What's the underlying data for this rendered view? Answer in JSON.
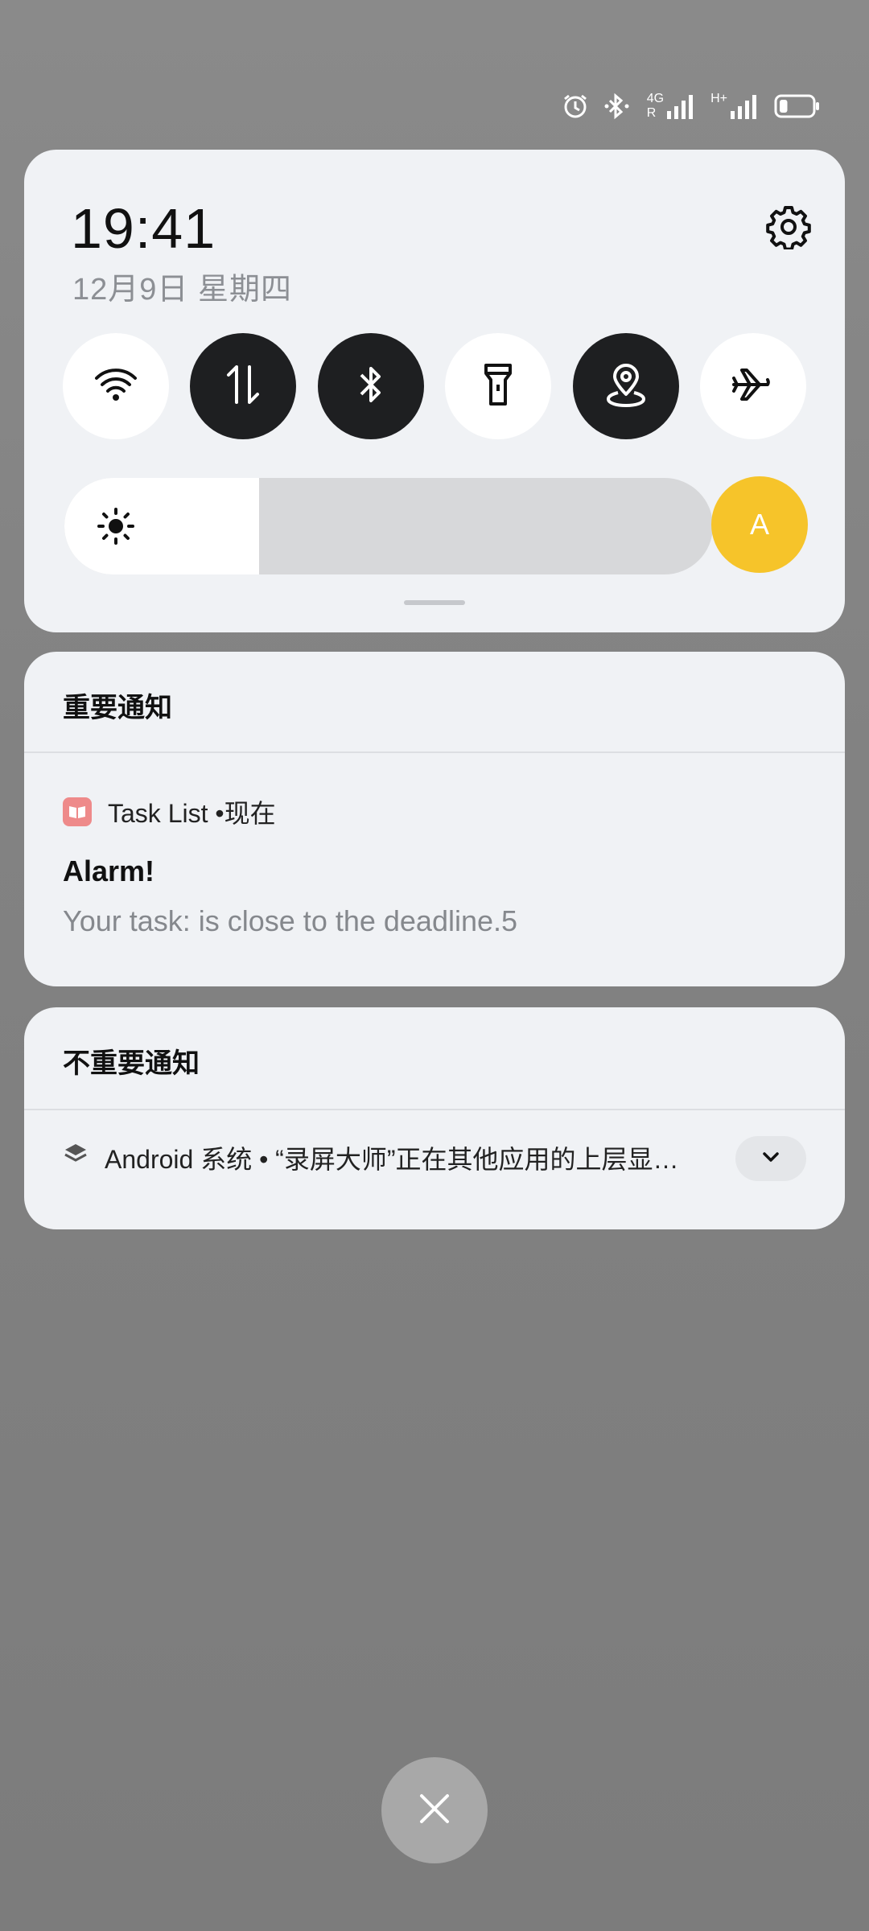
{
  "status_bar": {
    "icons": [
      "alarm-icon",
      "bluetooth-icon",
      "signal-4g-icon",
      "signal-h-plus-icon",
      "battery-icon"
    ],
    "network_1": "4G",
    "network_1_sub": "R",
    "network_2": "H+",
    "battery_level": 0.25
  },
  "quick_settings": {
    "time": "19:41",
    "date": "12月9日  星期四",
    "settings_icon": "gear-icon",
    "tiles": [
      {
        "name": "wifi",
        "icon": "wifi-icon",
        "active": false
      },
      {
        "name": "mobile-data",
        "icon": "data-arrows-icon",
        "active": true
      },
      {
        "name": "bluetooth",
        "icon": "bluetooth-icon",
        "active": true
      },
      {
        "name": "flashlight",
        "icon": "flashlight-icon",
        "active": false
      },
      {
        "name": "location",
        "icon": "location-icon",
        "active": true
      },
      {
        "name": "airplane",
        "icon": "airplane-icon",
        "active": false
      }
    ],
    "brightness_level": 0.3,
    "auto_brightness_label": "A",
    "colors": {
      "active_tile": "#1e1f21",
      "auto_button": "#f6c42a"
    }
  },
  "important_section": {
    "title": "重要通知",
    "notification": {
      "app_icon": "task-list-app-icon",
      "app_name": "Task List",
      "separator": "•",
      "time": "现在",
      "title": "Alarm!",
      "body": "Your task:  is close to the deadline.5"
    }
  },
  "unimportant_section": {
    "title": "不重要通知",
    "notification": {
      "app_icon": "layers-icon",
      "summary": "Android 系统 • “录屏大师”正在其他应用的上层显…",
      "expand_icon": "chevron-down-icon"
    }
  },
  "close_button": {
    "icon": "close-icon"
  }
}
